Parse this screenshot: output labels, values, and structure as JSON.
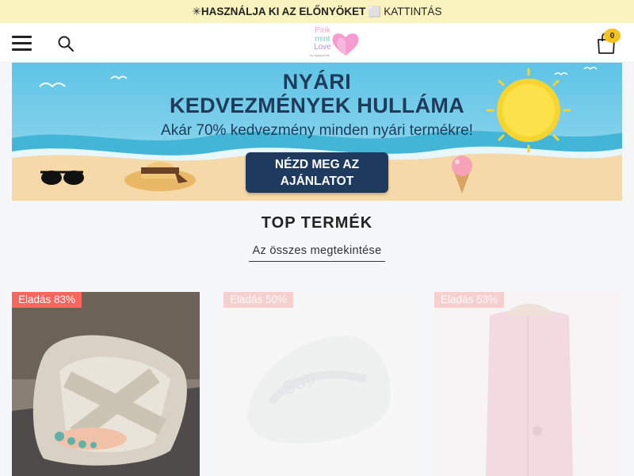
{
  "announcement": {
    "bold": "✳HASZNÁLJA KI AZ ELŐNYÖKET",
    "separator": "⬜",
    "link": "KATTINTÁS"
  },
  "header": {
    "logo": {
      "line1": "Pink",
      "line2": "mint",
      "line3": "Love",
      "byline": "by nippyprints"
    },
    "cart_count": "0"
  },
  "banner": {
    "title_line1": "NYÁRI",
    "title_line2": "KEDVEZMÉNYEK HULLÁMA",
    "subtitle": "Akár 70% kedvezmény minden nyári termékre!",
    "cta_line1": "NÉZD MEG AZ",
    "cta_line2": "AJÁNLATOT",
    "colors": {
      "sky": "#5ec4e6",
      "sea": "#43b6d8",
      "sand": "#f6d9a8",
      "sun": "#f8d52e",
      "cta": "#1e3a5f"
    }
  },
  "top_products": {
    "title": "TOP TERMÉK",
    "view_all": "Az összes megtekintése",
    "products": [
      {
        "badge": "Eladás 83%"
      },
      {
        "badge": "Eladás 50%"
      },
      {
        "badge": "Eladás 53%"
      }
    ]
  },
  "colors": {
    "announcement_bg": "#fbf3bf",
    "sale_badge": "#f9665e",
    "cart_badge": "#f7c21b"
  }
}
